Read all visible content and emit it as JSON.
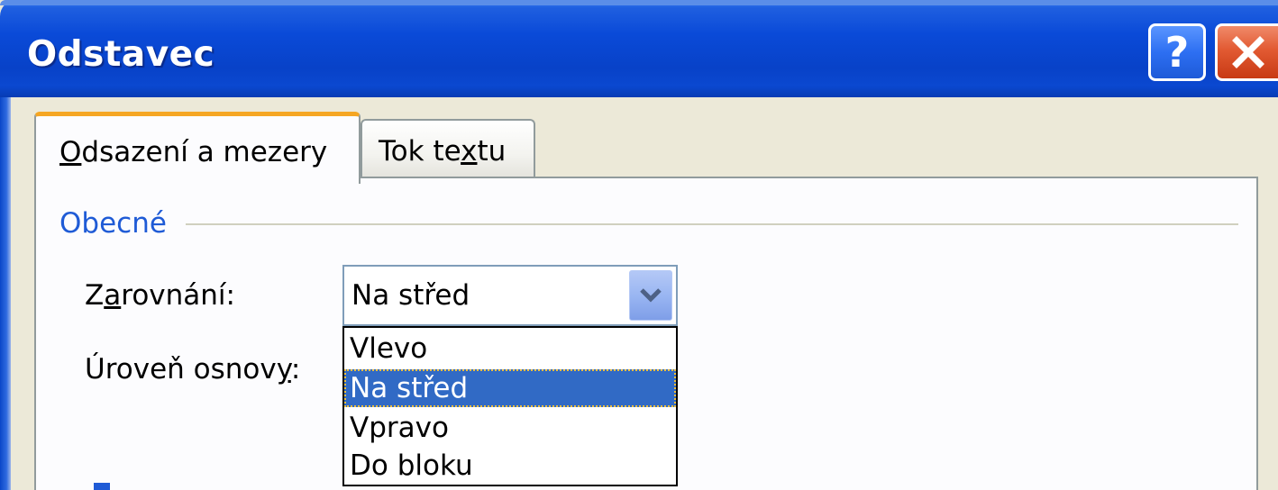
{
  "window": {
    "title": "Odstavec"
  },
  "titlebar": {
    "help_label": "?"
  },
  "tabs": [
    {
      "label_pre": "",
      "label_accel": "O",
      "label_post": "dsazení a mezery",
      "active": true
    },
    {
      "label_pre": "Tok te",
      "label_accel": "x",
      "label_post": "tu",
      "active": false
    }
  ],
  "general": {
    "group_label": "Obecné",
    "alignment": {
      "label_pre": "Z",
      "label_accel": "a",
      "label_post": "rovnání:",
      "value": "Na střed",
      "options": [
        "Vlevo",
        "Na střed",
        "Vpravo",
        "Do bloku"
      ],
      "selected_index": 1
    },
    "outline_level": {
      "label_pre": "Úroveň osnov",
      "label_accel": "y",
      "label_post": ":"
    }
  },
  "colors": {
    "titlebar": "#0842c8",
    "tab_highlight": "#f5a623",
    "group_label": "#1f5bd6",
    "selection": "#316ac5",
    "close": "#e25a32"
  }
}
